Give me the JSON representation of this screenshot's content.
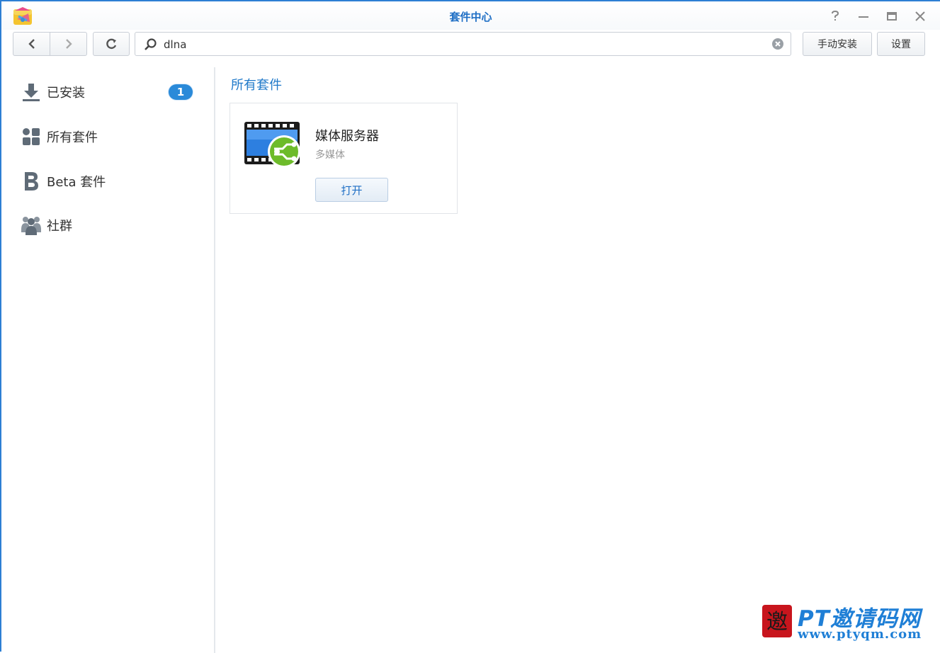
{
  "window": {
    "title": "套件中心"
  },
  "toolbar": {
    "search_value": "dlna",
    "manual_install_label": "手动安装",
    "settings_label": "设置"
  },
  "sidebar": {
    "items": [
      {
        "label": "已安装",
        "icon": "download-icon",
        "badge": "1"
      },
      {
        "label": "所有套件",
        "icon": "grid-icon"
      },
      {
        "label": "Beta 套件",
        "icon": "beta-icon"
      },
      {
        "label": "社群",
        "icon": "community-icon"
      }
    ]
  },
  "main": {
    "section_title": "所有套件",
    "packages": [
      {
        "name": "媒体服务器",
        "category": "多媒体",
        "action_label": "打开",
        "icon": "media-server-icon"
      }
    ]
  },
  "watermark": {
    "title": "PT邀请码网",
    "url": "www.ptyqm.com",
    "seal_char": "邀"
  },
  "colors": {
    "accent": "#1f79c9",
    "badge": "#2a8ad9",
    "border": "#2d7fd3"
  }
}
